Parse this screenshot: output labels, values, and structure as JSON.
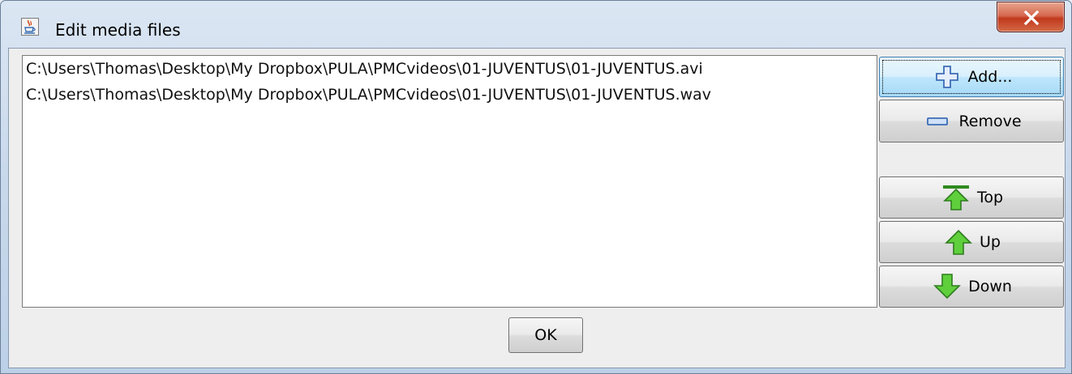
{
  "window": {
    "title": "Edit media files"
  },
  "file_list": {
    "items": [
      "C:\\Users\\Thomas\\Desktop\\My Dropbox\\PULA\\PMCvideos\\01-JUVENTUS\\01-JUVENTUS.avi",
      "C:\\Users\\Thomas\\Desktop\\My Dropbox\\PULA\\PMCvideos\\01-JUVENTUS\\01-JUVENTUS.wav"
    ]
  },
  "buttons": {
    "add": "Add...",
    "remove": "Remove",
    "top": "Top",
    "up": "Up",
    "down": "Down",
    "ok": "OK"
  },
  "icons": {
    "app": "java-cup-icon",
    "close": "close-icon",
    "add": "plus-icon",
    "remove": "minus-icon",
    "top": "arrow-top-icon",
    "up": "arrow-up-icon",
    "down": "arrow-down-icon"
  },
  "colors": {
    "close_red": "#c1391d",
    "arrow_green": "#3fae2a",
    "focus_blue": "#bee6fd"
  }
}
